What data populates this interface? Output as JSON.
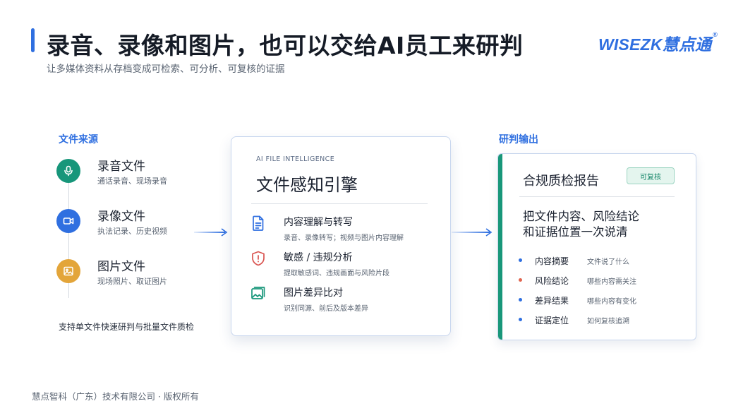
{
  "header": {
    "title": "录音、录像和图片，也可以交给AI员工来研判",
    "subtitle": "让多媒体资料从存档变成可检索、可分析、可复核的证据",
    "logo_text": "WISEZK慧点通",
    "logo_mark": "®"
  },
  "sources": {
    "section_label": "文件来源",
    "items": [
      {
        "title": "录音文件",
        "desc": "通话录音、现场录音",
        "icon": "microphone-icon",
        "color": "#17967a"
      },
      {
        "title": "录像文件",
        "desc": "执法记录、历史视频",
        "icon": "video-camera-icon",
        "color": "#2f6fe0"
      },
      {
        "title": "图片文件",
        "desc": "现场照片、取证图片",
        "icon": "image-icon",
        "color": "#e3a53a"
      }
    ],
    "note": "支持单文件快速研判与批量文件质检"
  },
  "engine": {
    "kicker": "AI FILE INTELLIGENCE",
    "title": "文件感知引擎",
    "features": [
      {
        "title": "内容理解与转写",
        "desc": "录音、录像转写；视频与图片内容理解",
        "icon": "document-icon",
        "color": "#2f6fe0"
      },
      {
        "title": "敏感 / 违规分析",
        "desc": "提取敏感词、违规画面与风险片段",
        "icon": "shield-alert-icon",
        "color": "#d9534f"
      },
      {
        "title": "图片差异比对",
        "desc": "识别同源、前后及版本差异",
        "icon": "image-compare-icon",
        "color": "#17967a"
      }
    ]
  },
  "output": {
    "section_label": "研判输出",
    "report_title": "合规质检报告",
    "badge": "可复核",
    "summary_line1": "把文件内容、风险结论",
    "summary_line2": "和证据位置一次说清",
    "items": [
      {
        "label": "内容摘要",
        "desc": "文件说了什么",
        "color": "#2f6fe0"
      },
      {
        "label": "风险结论",
        "desc": "哪些内容需关注",
        "color": "#e0654f"
      },
      {
        "label": "差异结果",
        "desc": "哪些内容有变化",
        "color": "#2f6fe0"
      },
      {
        "label": "证据定位",
        "desc": "如何复核追溯",
        "color": "#2f6fe0"
      }
    ]
  },
  "footer": {
    "copyright": "慧点智科（广东）技术有限公司 · 版权所有"
  },
  "colors": {
    "accent": "#2f6fe0",
    "green": "#17967a",
    "arrow_left": "#7fa4e8",
    "arrow_right": "#9ab8ec"
  }
}
